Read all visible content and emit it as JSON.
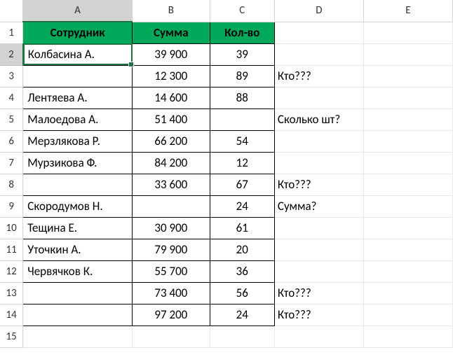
{
  "columns": [
    "A",
    "B",
    "C",
    "D",
    "E"
  ],
  "row_numbers": [
    "1",
    "2",
    "3",
    "4",
    "5",
    "6",
    "7",
    "8",
    "9",
    "10",
    "11",
    "12",
    "13",
    "14",
    "15"
  ],
  "header": {
    "employee": "Сотрудник",
    "sum": "Сумма",
    "qty": "Кол-во"
  },
  "rows": [
    {
      "employee": "Колбасина А.",
      "sum": "39 900",
      "qty": "39",
      "note": ""
    },
    {
      "employee": "",
      "sum": "12 300",
      "qty": "89",
      "note": "Кто???"
    },
    {
      "employee": "Лентяева А.",
      "sum": "14 600",
      "qty": "88",
      "note": ""
    },
    {
      "employee": "Малоедова А.",
      "sum": "51 400",
      "qty": "",
      "note": "Сколько шт?"
    },
    {
      "employee": "Мерзлякова Р.",
      "sum": "66 200",
      "qty": "54",
      "note": ""
    },
    {
      "employee": "Мурзикова Ф.",
      "sum": "84 200",
      "qty": "12",
      "note": ""
    },
    {
      "employee": "",
      "sum": "33 600",
      "qty": "67",
      "note": "Кто???"
    },
    {
      "employee": "Скородумов Н.",
      "sum": "",
      "qty": "24",
      "note": "Сумма?"
    },
    {
      "employee": "Тещина Е.",
      "sum": "30 900",
      "qty": "61",
      "note": ""
    },
    {
      "employee": "Уточкин А.",
      "sum": "79 900",
      "qty": "20",
      "note": ""
    },
    {
      "employee": "Червячков К.",
      "sum": "55 700",
      "qty": "36",
      "note": ""
    },
    {
      "employee": "",
      "sum": "73 400",
      "qty": "56",
      "note": "Кто???"
    },
    {
      "employee": "",
      "sum": "97 200",
      "qty": "24",
      "note": "Кто???"
    }
  ],
  "selected_cell": "A2"
}
